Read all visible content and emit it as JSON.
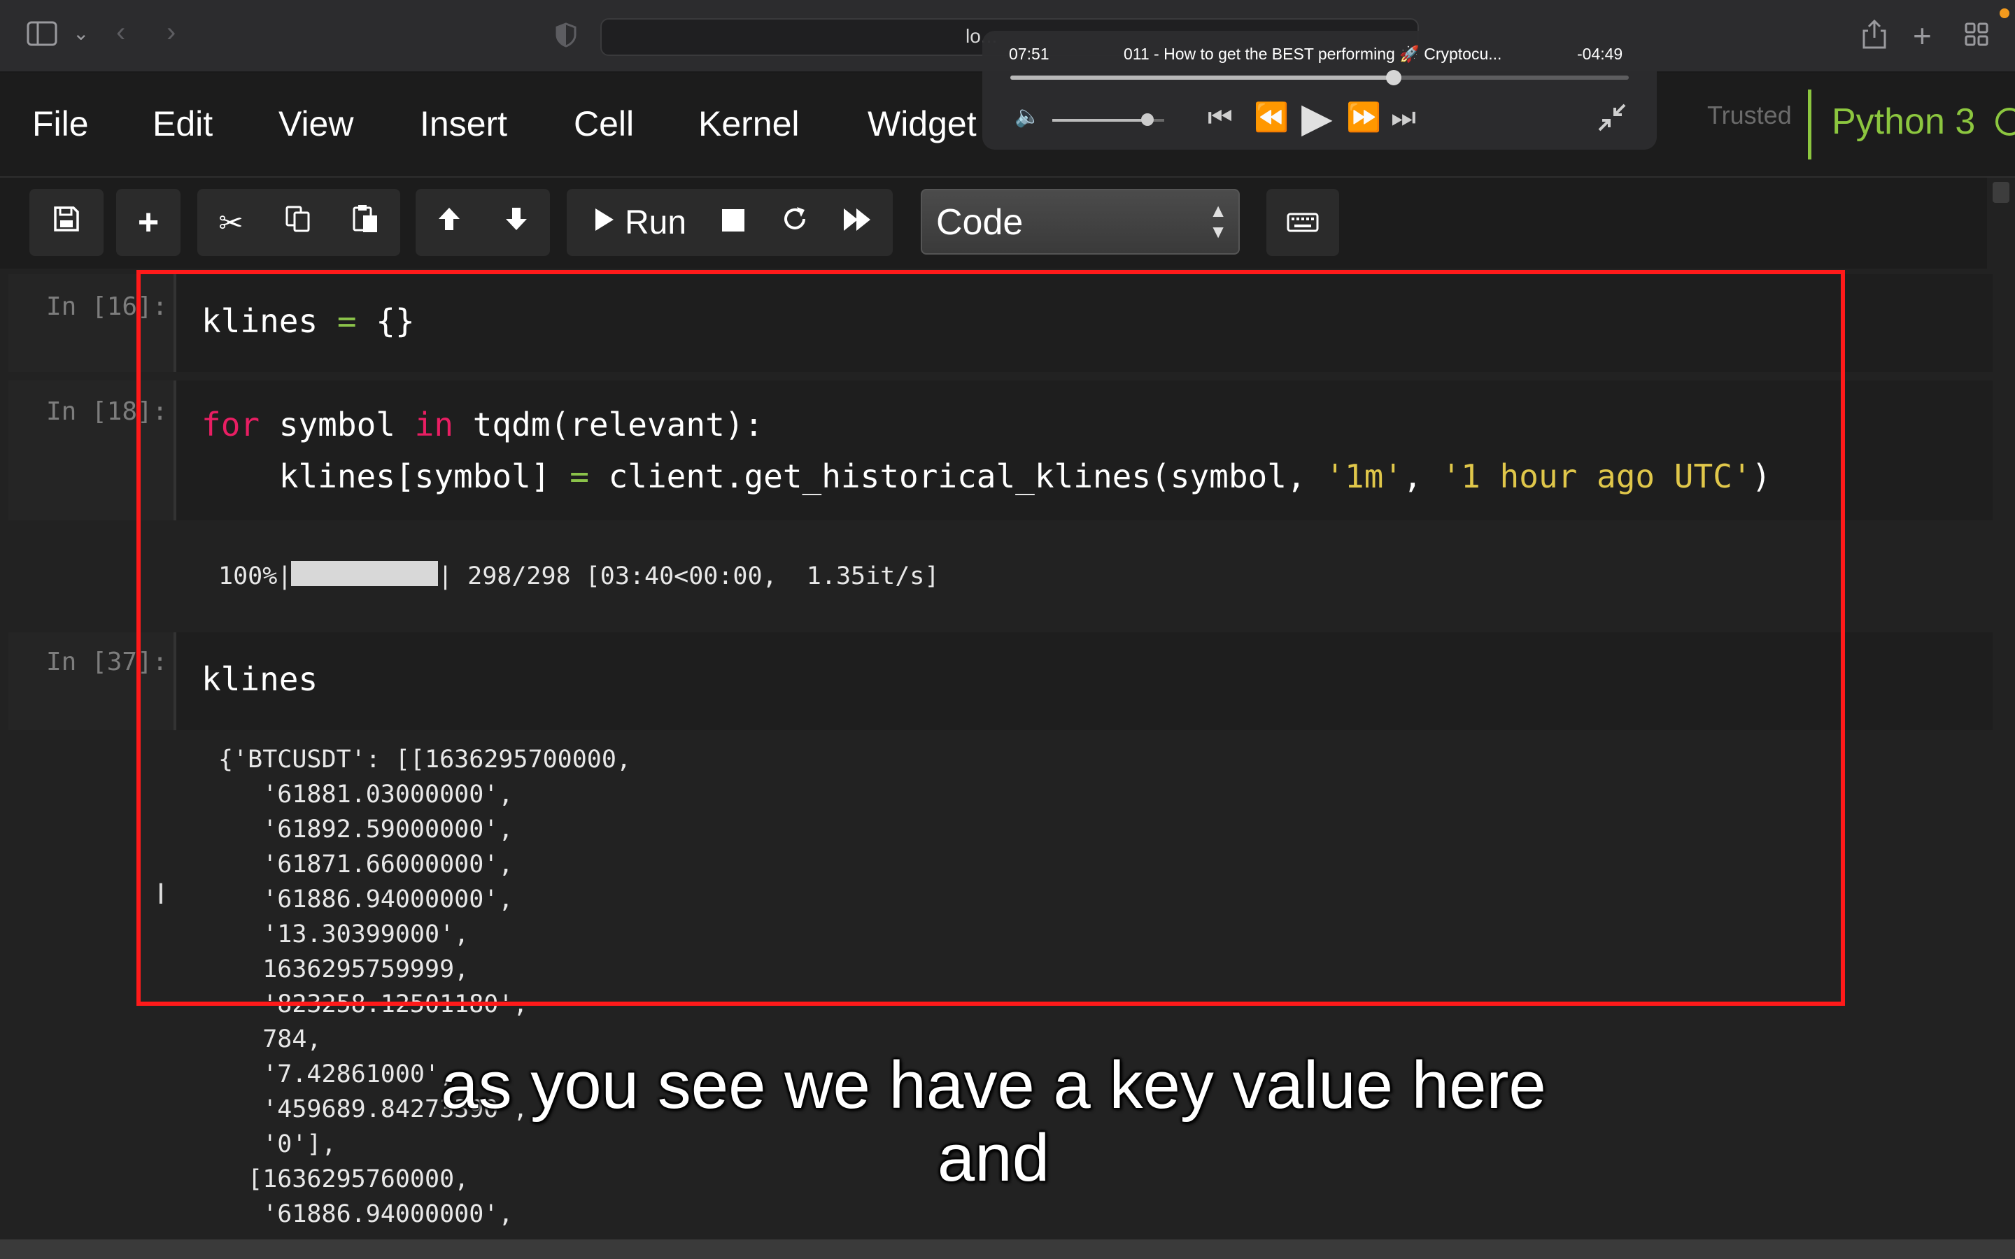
{
  "browser": {
    "address_text": "lo...",
    "icons": [
      "sidebar-icon",
      "chevron-down-icon",
      "back-icon",
      "forward-icon",
      "shield-icon",
      "share-icon",
      "new-tab-icon",
      "tab-overview-icon"
    ]
  },
  "menu": {
    "items": [
      "File",
      "Edit",
      "View",
      "Insert",
      "Cell",
      "Kernel",
      "Widget"
    ],
    "trusted": "Trusted",
    "kernel": "Python 3"
  },
  "toolbar": {
    "run_label": "Run",
    "cell_type": "Code",
    "icons": [
      "save-icon",
      "plus-icon",
      "scissors-icon",
      "copy-icon",
      "paste-icon",
      "arrow-up-icon",
      "arrow-down-icon",
      "play-icon",
      "stop-icon",
      "restart-icon",
      "fast-forward-icon",
      "keyboard-icon"
    ]
  },
  "cells": [
    {
      "prompt": "In [16]:",
      "code": {
        "text": "klines = {}"
      }
    },
    {
      "prompt": "In [18]:",
      "code": {
        "line1_kw1": "for",
        "line1_mid": " symbol ",
        "line1_kw2": "in",
        "line1_end": " tqdm(relevant):",
        "line2_start": "    klines[symbol] ",
        "line2_op": "=",
        "line2_mid": " client.get_historical_klines(symbol, ",
        "line2_s1": "'1m'",
        "line2_comma": ", ",
        "line2_s2": "'1 hour ago UTC'",
        "line2_end": ")"
      },
      "output": {
        "percent": "100%|",
        "progress_fraction": 1.0,
        "rest": "| 298/298 [03:40<00:00,  1.35it/s]"
      }
    },
    {
      "prompt": "In [37]:",
      "code": {
        "text": "klines"
      },
      "output_lines": [
        "{'BTCUSDT': [[1636295700000,",
        "   '61881.03000000',",
        "   '61892.59000000',",
        "   '61871.66000000',",
        "   '61886.94000000',",
        "   '13.30399000',",
        "   1636295759999,",
        "   '823258.12501180',",
        "   784,",
        "   '7.42861000',",
        "   '459689.84273390',",
        "   '0'],",
        "  [1636295760000,",
        "   '61886.94000000',"
      ]
    }
  ],
  "player": {
    "elapsed": "07:51",
    "title": "011 - How to get the BEST performing 🚀 Cryptocu...",
    "remaining": "-04:49",
    "progress_fraction": 0.62,
    "volume_fraction": 0.85
  },
  "caption": {
    "line1": "as you see we have a key value here",
    "line2": "and"
  },
  "colors": {
    "keyword": "#e91e63",
    "operator": "#8bc34a",
    "string": "#e0c74a",
    "kernel": "#8cc63f",
    "highlight_box": "#ff1a1a"
  }
}
